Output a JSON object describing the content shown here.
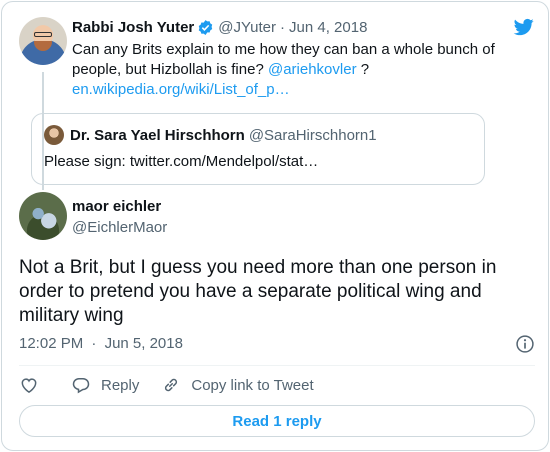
{
  "parent_tweet": {
    "author_name": "Rabbi Josh Yuter",
    "handle": "@JYuter",
    "separator": "·",
    "date": "Jun 4, 2018",
    "text_before_mention": "Can any Brits explain to me how they can ban a whole bunch of people, but Hizbollah is fine? ",
    "mention": "@ariehkovler",
    "text_after_mention": " ?",
    "link": "en.wikipedia.org/wiki/List_of_p…",
    "quote": {
      "author_name": "Dr. Sara Yael Hirschhorn",
      "handle": "@SaraHirschhorn1",
      "text": "Please sign: twitter.com/Mendelpol/stat…"
    }
  },
  "main_tweet": {
    "author_name": "maor eichler",
    "handle": "@EichlerMaor",
    "text": "Not a Brit, but I guess you need more than one person in order to pretend you have a separate political wing and military wing",
    "time": "12:02 PM",
    "separator": "·",
    "date": "Jun 5, 2018"
  },
  "actions": {
    "reply_label": "Reply",
    "copy_link_label": "Copy link to Tweet"
  },
  "read_replies_label": "Read 1 reply",
  "colors": {
    "accent": "#1d9bf0",
    "text_primary": "#0f1419",
    "text_secondary": "#536471",
    "border": "#cfd9de"
  },
  "icons": [
    "verified-badge-icon",
    "twitter-bird-icon",
    "info-icon",
    "heart-icon",
    "reply-icon",
    "link-icon"
  ]
}
